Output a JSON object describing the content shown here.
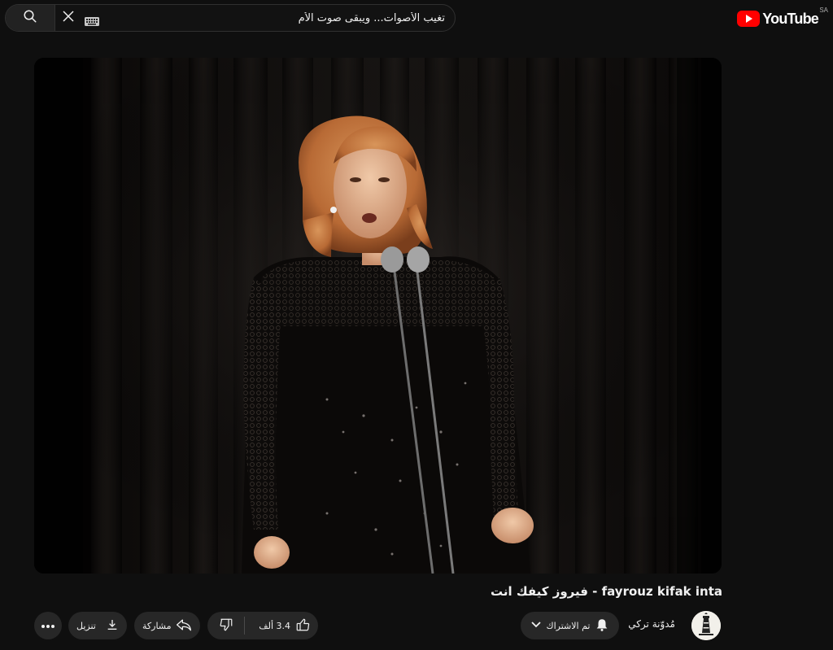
{
  "header": {
    "logo_text": "YouTube",
    "country_code": "SA",
    "search": {
      "value": "تغيب الأصوات... ويبقى صوت الأم"
    }
  },
  "icons": {
    "search": "search-icon",
    "clear": "close-icon",
    "keyboard": "keyboard-icon",
    "more": "more-horizontal-icon",
    "download": "download-icon",
    "share": "share-icon",
    "dislike": "thumbs-down-icon",
    "like": "thumbs-up-icon",
    "bell": "bell-icon",
    "chevron": "chevron-down-icon"
  },
  "video": {
    "title": "فيروز كيفك انت - fayrouz kifak inta"
  },
  "actions": {
    "download_label": "تنزيل",
    "share_label": "مشاركة",
    "like_count": "3.4 ألف",
    "subscribe_label": "تم الاشتراك"
  },
  "channel": {
    "name": "مُدوّنة تركي"
  },
  "colors": {
    "background": "#0f0f0f",
    "pill": "#272727",
    "accent": "#ff0000",
    "text": "#f1f1f1"
  }
}
